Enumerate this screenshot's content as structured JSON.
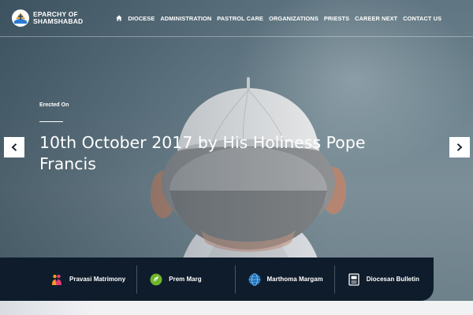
{
  "brand": {
    "line1": "EPARCHY OF",
    "line2": "SHAMSHABAD"
  },
  "nav": {
    "home_icon": "home-icon",
    "items": [
      "DIOCESE",
      "ADMINISTRATION",
      "PASTROL CARE",
      "ORGANIZATIONS",
      "PRIESTS",
      "CAREER NEXT",
      "CONTACT US"
    ]
  },
  "slide": {
    "pre_title": "Erected On",
    "title_line1": "10th October 2017 by His Holiness Pope",
    "title_line2": "Francis"
  },
  "slider": {
    "prev_icon": "chevron-left-icon",
    "next_icon": "chevron-right-icon"
  },
  "quick_links": [
    {
      "label": "Pravasi Matrimony",
      "icon": "matrimony-icon"
    },
    {
      "label": "Prem Marg",
      "icon": "prem-marg-icon"
    },
    {
      "label": "Marthoma Margam",
      "icon": "marthoma-globe-icon"
    },
    {
      "label": "Diocesan Bulletin",
      "icon": "bulletin-icon"
    }
  ],
  "colors": {
    "quickbar_bg": "#0f1c2c",
    "hero_tint": "#6f8590",
    "text": "#ffffff"
  }
}
